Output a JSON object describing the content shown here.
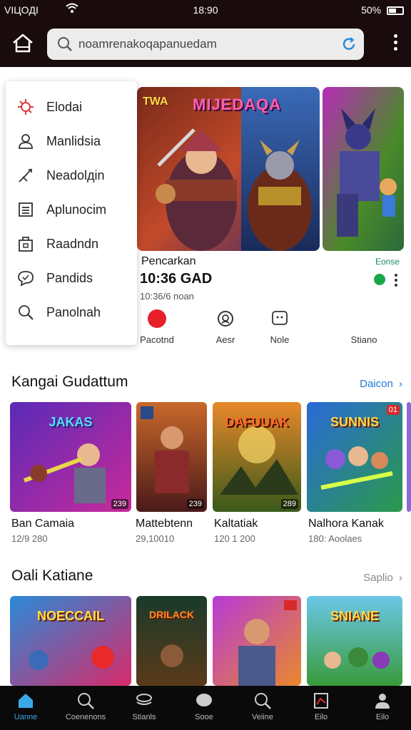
{
  "status": {
    "carrier": "VIЦOДI",
    "time": "18:90",
    "battery": "50%"
  },
  "search": {
    "value": "noamrenakoqapanuedam"
  },
  "menu": {
    "items": [
      {
        "label": "Elodai",
        "icon": "virus-icon"
      },
      {
        "label": "Manlidsia",
        "icon": "user-icon"
      },
      {
        "label": "Neadolдin",
        "icon": "sword-icon"
      },
      {
        "label": "Aplunocim",
        "icon": "list-icon"
      },
      {
        "label": "Raadndn",
        "icon": "bag-icon"
      },
      {
        "label": "Pandids",
        "icon": "chat-icon"
      },
      {
        "label": "Panolnah",
        "icon": "search-icon"
      }
    ]
  },
  "featured": {
    "banner_title": "MIJEDAQA",
    "banner_logo": "TWA",
    "name": "Pencarkan",
    "price": "10:36 GAD",
    "subtitle": "10:36/6 noan",
    "tag": "Eonse"
  },
  "actions": [
    {
      "label": "Pacotnd"
    },
    {
      "label": "Aesr"
    },
    {
      "label": "Nole"
    },
    {
      "label": "Stiano"
    }
  ],
  "section1": {
    "title": "Kangai Gudattum",
    "link": "Daicon",
    "cards": [
      {
        "art_title": "JAKAS",
        "badge": "239",
        "name": "Ban Camaia",
        "meta": "12/9 280"
      },
      {
        "art_title": "",
        "badge": "239",
        "name": "Mattebtenn",
        "meta": "29,10010"
      },
      {
        "art_title": "DAFUUAK",
        "badge": "289",
        "name": "Kaltatiak",
        "meta": "120 1 200"
      },
      {
        "art_title": "SUNNIS",
        "badge": "01",
        "name": "Nalhora Kanak",
        "meta": "180: Aoolaes"
      }
    ]
  },
  "section2": {
    "title": "Oali Katiane",
    "link": "Saplio",
    "cards": [
      {
        "art_title": "NOECCAIL"
      },
      {
        "art_title": "DRILACK"
      },
      {
        "art_title": ""
      },
      {
        "art_title": "SNIANE"
      }
    ]
  },
  "bottom_nav": [
    {
      "label": "Uanne",
      "icon": "home-icon",
      "active": true
    },
    {
      "label": "Coenenons",
      "icon": "search-icon",
      "active": false
    },
    {
      "label": "Stianls",
      "icon": "layers-icon",
      "active": false
    },
    {
      "label": "Sooe",
      "icon": "chat-bubble-icon",
      "active": false
    },
    {
      "label": "Veiine",
      "icon": "search-icon",
      "active": false
    },
    {
      "label": "Eilo",
      "icon": "chart-icon",
      "active": false
    },
    {
      "label": "Eilo",
      "icon": "profile-icon",
      "active": false
    }
  ],
  "colors": {
    "bar": "#1a0c0c",
    "accent": "#3aa8e8",
    "record": "#e8202a",
    "online": "#1aa64a"
  }
}
